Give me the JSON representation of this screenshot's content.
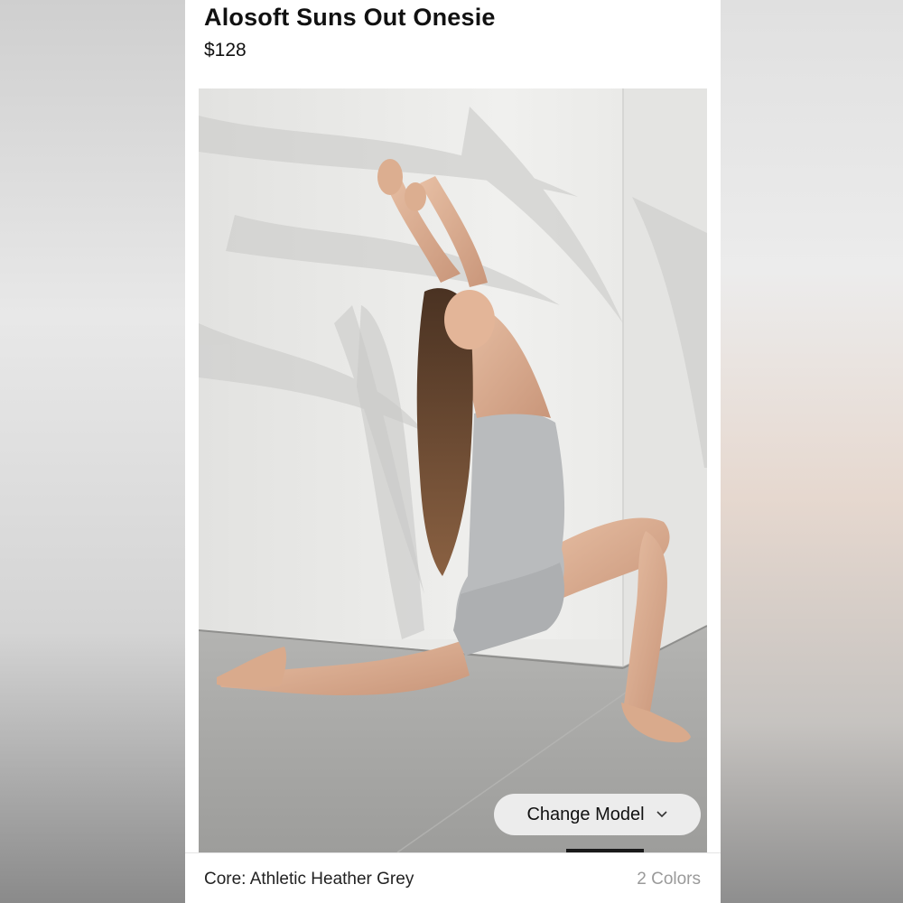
{
  "product": {
    "title": "Alosoft Suns Out Onesie",
    "price": "$128"
  },
  "image": {
    "change_model_label": "Change Model",
    "change_model_icon": "chevron-down-icon"
  },
  "color_bar": {
    "selected_color": "Core: Athletic Heather Grey",
    "color_count": "2 Colors"
  },
  "colors": {
    "onesie": "#b9bbbd",
    "background_wall": "#ececea",
    "floor": "#a9a9a9"
  }
}
